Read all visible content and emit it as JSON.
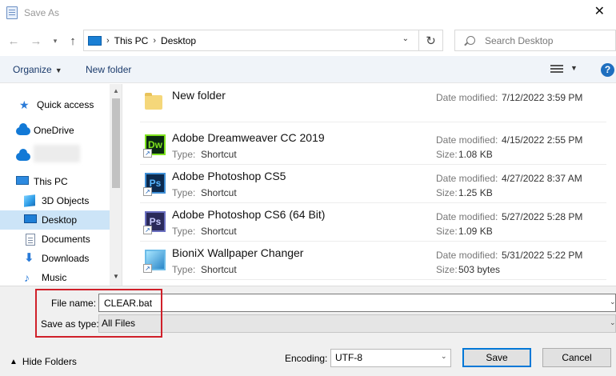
{
  "window": {
    "title": "Save As"
  },
  "nav": {
    "back_icon": "arrow-left-icon",
    "forward_icon": "arrow-right-icon",
    "recent_icon": "chevron-down-icon",
    "up_icon": "arrow-up-icon",
    "breadcrumbs": [
      "This PC",
      "Desktop"
    ],
    "search_placeholder": "Search Desktop"
  },
  "toolbar": {
    "organize": "Organize",
    "new_folder": "New folder"
  },
  "sidebar": {
    "items": [
      {
        "label": "Quick access",
        "icon": "star-icon"
      },
      {
        "label": "OneDrive",
        "icon": "cloud-icon"
      },
      {
        "label": "",
        "icon": "cloud-icon"
      },
      {
        "label": "This PC",
        "icon": "computer-icon"
      },
      {
        "label": "3D Objects",
        "icon": "cube-icon"
      },
      {
        "label": "Desktop",
        "icon": "desktop-icon",
        "selected": true
      },
      {
        "label": "Documents",
        "icon": "document-icon"
      },
      {
        "label": "Downloads",
        "icon": "download-icon"
      },
      {
        "label": "Music",
        "icon": "music-icon"
      }
    ]
  },
  "labels": {
    "date_modified": "Date modified:",
    "type": "Type:",
    "size": "Size:"
  },
  "files": [
    {
      "name": "New folder",
      "date_modified": "7/12/2022 3:59 PM"
    },
    {
      "name": "Adobe Dreamweaver CC 2019",
      "type": "Shortcut",
      "date_modified": "4/15/2022 2:55 PM",
      "size": "1.08 KB",
      "tile": "Dw"
    },
    {
      "name": "Adobe Photoshop CS5",
      "type": "Shortcut",
      "date_modified": "4/27/2022 8:37 AM",
      "size": "1.25 KB",
      "tile": "Ps"
    },
    {
      "name": "Adobe Photoshop CS6 (64 Bit)",
      "type": "Shortcut",
      "date_modified": "5/27/2022 5:28 PM",
      "size": "1.09 KB",
      "tile": "Ps"
    },
    {
      "name": "BioniX Wallpaper Changer",
      "type": "Shortcut",
      "date_modified": "5/31/2022 5:22 PM",
      "size": "503 bytes"
    }
  ],
  "form": {
    "file_name_label": "File name:",
    "file_name_value": "CLEAR.bat",
    "save_as_type_label": "Save as type:",
    "save_as_type_value": "All Files",
    "encoding_label": "Encoding:",
    "encoding_value": "UTF-8",
    "hide_folders": "Hide Folders",
    "save": "Save",
    "cancel": "Cancel"
  },
  "colors": {
    "highlight_box": "#d0202a",
    "selected_nav": "#cce4f7",
    "accent": "#0078d7"
  }
}
